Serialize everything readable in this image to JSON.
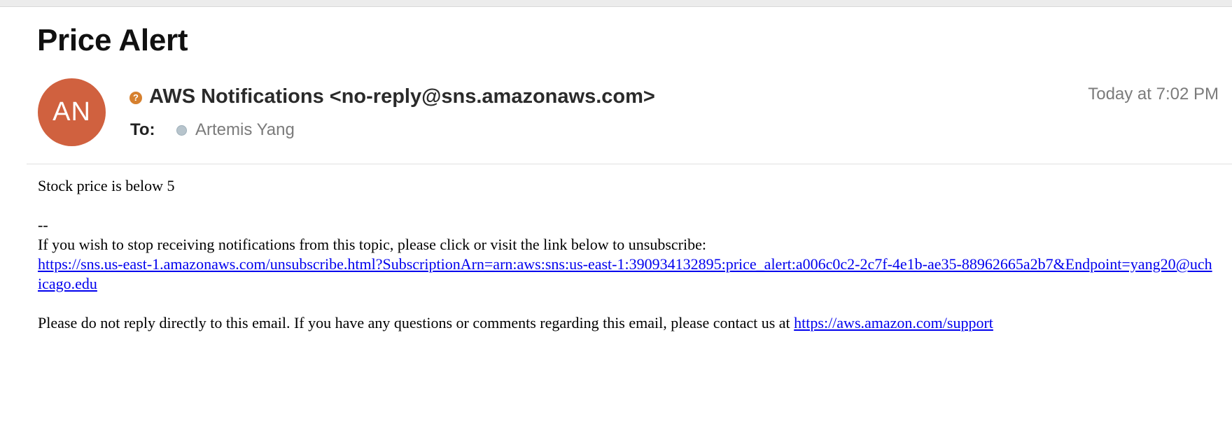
{
  "email": {
    "subject": "Price Alert",
    "avatar_initials": "AN",
    "avatar_color": "#d0613f",
    "unverified_icon": "question-circle-icon",
    "sender": "AWS Notifications <no-reply@sns.amazonaws.com>",
    "to_label": "To:",
    "recipient": "Artemis Yang",
    "date": "Today at 7:02 PM"
  },
  "body": {
    "line1": "Stock price is below 5",
    "separator": "--",
    "unsubscribe_text": "If you wish to stop receiving notifications from this topic, please click or visit the link below to unsubscribe:",
    "unsubscribe_link": "https://sns.us-east-1.amazonaws.com/unsubscribe.html?SubscriptionArn=arn:aws:sns:us-east-1:390934132895:price_alert:a006c0c2-2c7f-4e1b-ae35-88962665a2b7&Endpoint=yang20@uchicago.edu",
    "noreply_text": "Please do not reply directly to this email. If you have any questions or comments regarding this email, please contact us at ",
    "support_link": "https://aws.amazon.com/support"
  },
  "colors": {
    "link": "#0000ee",
    "unverified": "#d6802e"
  }
}
